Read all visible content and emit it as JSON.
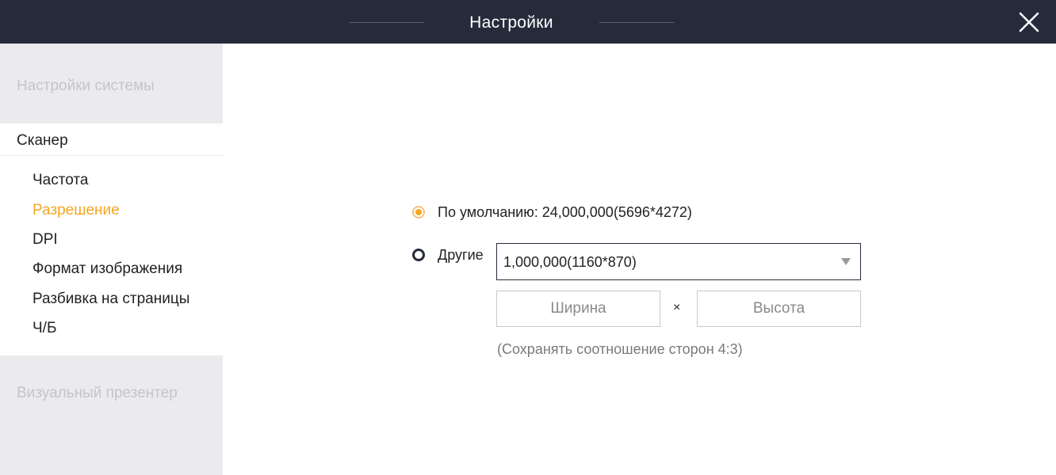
{
  "window": {
    "title": "Настройки"
  },
  "icons": {
    "close": "close-icon",
    "dropdown": "triangle-down-icon"
  },
  "colors": {
    "titlebar": "#252b3b",
    "accent": "#f5a623",
    "sidebar_bg": "#ebebed"
  },
  "sidebar": {
    "system_settings": "Настройки системы",
    "scanner": {
      "label": "Сканер",
      "items": [
        {
          "label": "Частота",
          "selected": false
        },
        {
          "label": "Разрешение",
          "selected": true
        },
        {
          "label": "DPI",
          "selected": false
        },
        {
          "label": "Формат изображения",
          "selected": false
        },
        {
          "label": "Разбивка на страницы",
          "selected": false
        },
        {
          "label": "Ч/Б",
          "selected": false
        }
      ]
    },
    "visual_presenter": "Визуальный презентер"
  },
  "resolution": {
    "default_option": {
      "label": "По умолчанию: 24,000,000(5696*4272)",
      "checked": true
    },
    "other_option": {
      "label": "Другие",
      "checked": false
    },
    "select": {
      "value": "1,000,000(1160*870)"
    },
    "width_placeholder": "Ширина",
    "times": "×",
    "height_placeholder": "Высота",
    "hint": "(Сохранять соотношение сторон 4:3)"
  }
}
